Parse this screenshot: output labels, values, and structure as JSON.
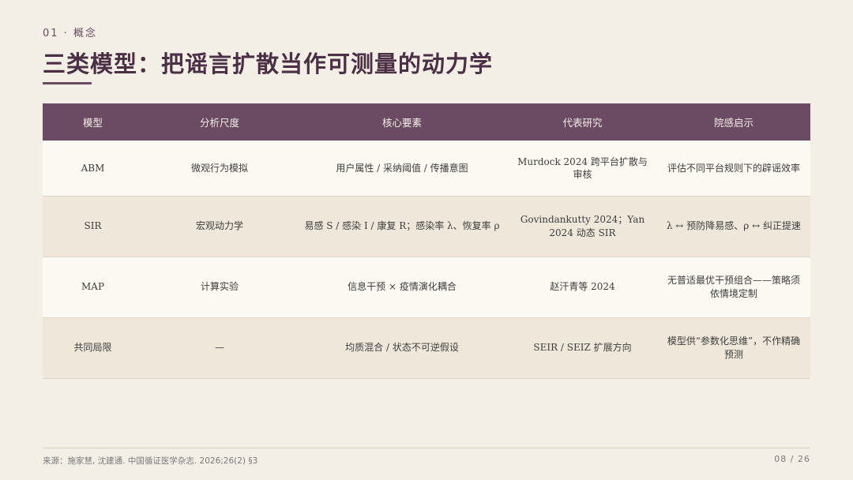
{
  "header": {
    "section_label": "01 · 概念",
    "title": "三类模型：把谣言扩散当作可测量的动力学"
  },
  "table": {
    "headers": [
      "模型",
      "分析尺度",
      "核心要素",
      "代表研究",
      "院感启示"
    ],
    "rows": [
      [
        "ABM",
        "微观行为模拟",
        "用户属性 / 采纳阈值 / 传播意图",
        "Murdock 2024 跨平台扩散与审核",
        "评估不同平台规则下的辟谣效率"
      ],
      [
        "SIR",
        "宏观动力学",
        "易感 S / 感染 I / 康复 R；感染率 λ、恢复率 ρ",
        "Govindankutty 2024；Yan 2024 动态 SIR",
        "λ ↔ 预防降易感、ρ ↔ 纠正提速"
      ],
      [
        "MAP",
        "计算实验",
        "信息干预 × 疫情演化耦合",
        "赵汗青等 2024",
        "无普适最优干预组合——策略须依情境定制"
      ],
      [
        "共同局限",
        "—",
        "均质混合 / 状态不可逆假设",
        "SEIR / SEIZ 扩展方向",
        "模型供“参数化思维”，不作精确预测"
      ]
    ]
  },
  "footer": {
    "source": "来源：施家慧, 沈建通. 中国循证医学杂志. 2026;26(2) §3",
    "page": "08 / 26"
  }
}
